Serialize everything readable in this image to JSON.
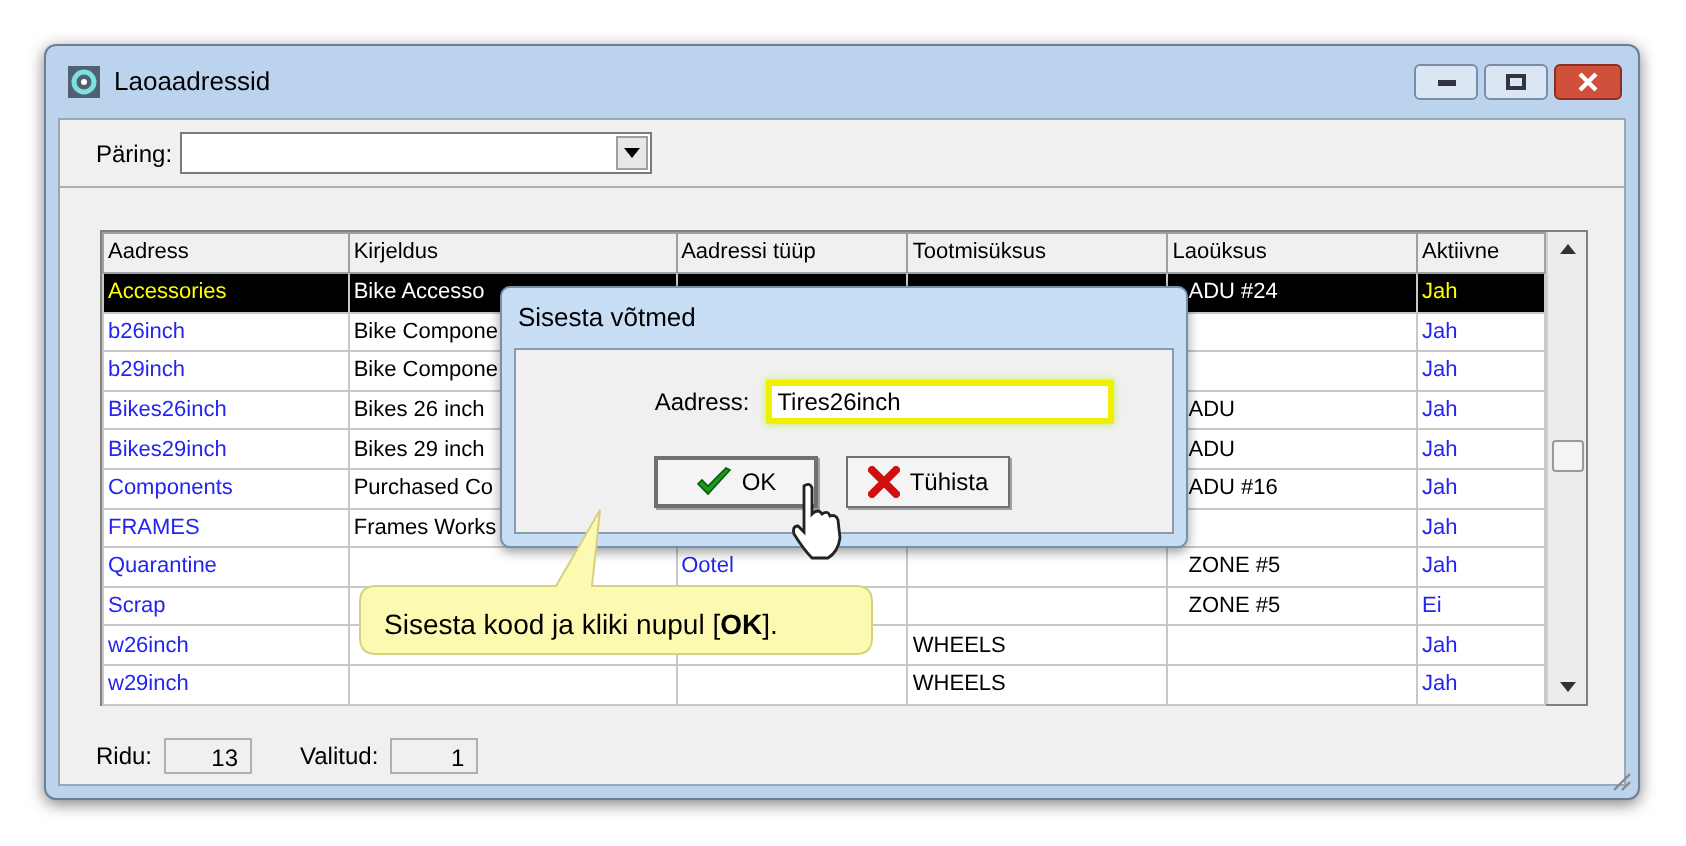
{
  "window": {
    "title": "Laoaadressid"
  },
  "query": {
    "label": "Päring:"
  },
  "table": {
    "columns": [
      "Aadress",
      "Kirjeldus",
      "Aadressi tüüp",
      "Tootmisüksus",
      "Laoüksus",
      "Aktiivne"
    ],
    "rows": [
      {
        "selected": true,
        "cells": [
          "Accessories",
          "Bike Accesso",
          "",
          "",
          "ADU #24",
          "Jah"
        ]
      },
      {
        "selected": false,
        "cells": [
          "b26inch",
          "Bike Compone",
          "",
          "",
          "",
          "Jah"
        ]
      },
      {
        "selected": false,
        "cells": [
          "b29inch",
          "Bike Compone",
          "",
          "",
          "",
          "Jah"
        ]
      },
      {
        "selected": false,
        "cells": [
          "Bikes26inch",
          "Bikes 26 inch",
          "",
          "",
          "ADU",
          "Jah"
        ]
      },
      {
        "selected": false,
        "cells": [
          "Bikes29inch",
          "Bikes 29 inch",
          "",
          "",
          "ADU",
          "Jah"
        ]
      },
      {
        "selected": false,
        "cells": [
          "Components",
          "Purchased Co",
          "",
          "",
          "ADU #16",
          "Jah"
        ]
      },
      {
        "selected": false,
        "cells": [
          "FRAMES",
          "Frames Works",
          "",
          "",
          "",
          "Jah"
        ]
      },
      {
        "selected": false,
        "cells": [
          "Quarantine",
          "",
          "Ootel",
          "",
          "ZONE #5",
          "Jah"
        ]
      },
      {
        "selected": false,
        "cells": [
          "Scrap",
          "",
          "",
          "",
          "ZONE #5",
          "Ei"
        ]
      },
      {
        "selected": false,
        "cells": [
          "w26inch",
          "",
          "",
          "WHEELS",
          "",
          "Jah"
        ]
      },
      {
        "selected": false,
        "cells": [
          "w29inch",
          "",
          "",
          "WHEELS",
          "",
          "Jah"
        ]
      }
    ]
  },
  "status_bar": {
    "rows_label": "Ridu:",
    "rows_value": "13",
    "selected_label": "Valitud:",
    "selected_value": "1"
  },
  "dialog": {
    "title": "Sisesta võtmed",
    "field_label": "Aadress:",
    "field_value": "Tires26inch",
    "buttons": [
      {
        "kind": "ok",
        "label": "OK"
      },
      {
        "kind": "cancel",
        "label": "Tühista"
      }
    ]
  },
  "callout": {
    "text": "Sisesta kood ja kliki nupul [**OK**]."
  }
}
